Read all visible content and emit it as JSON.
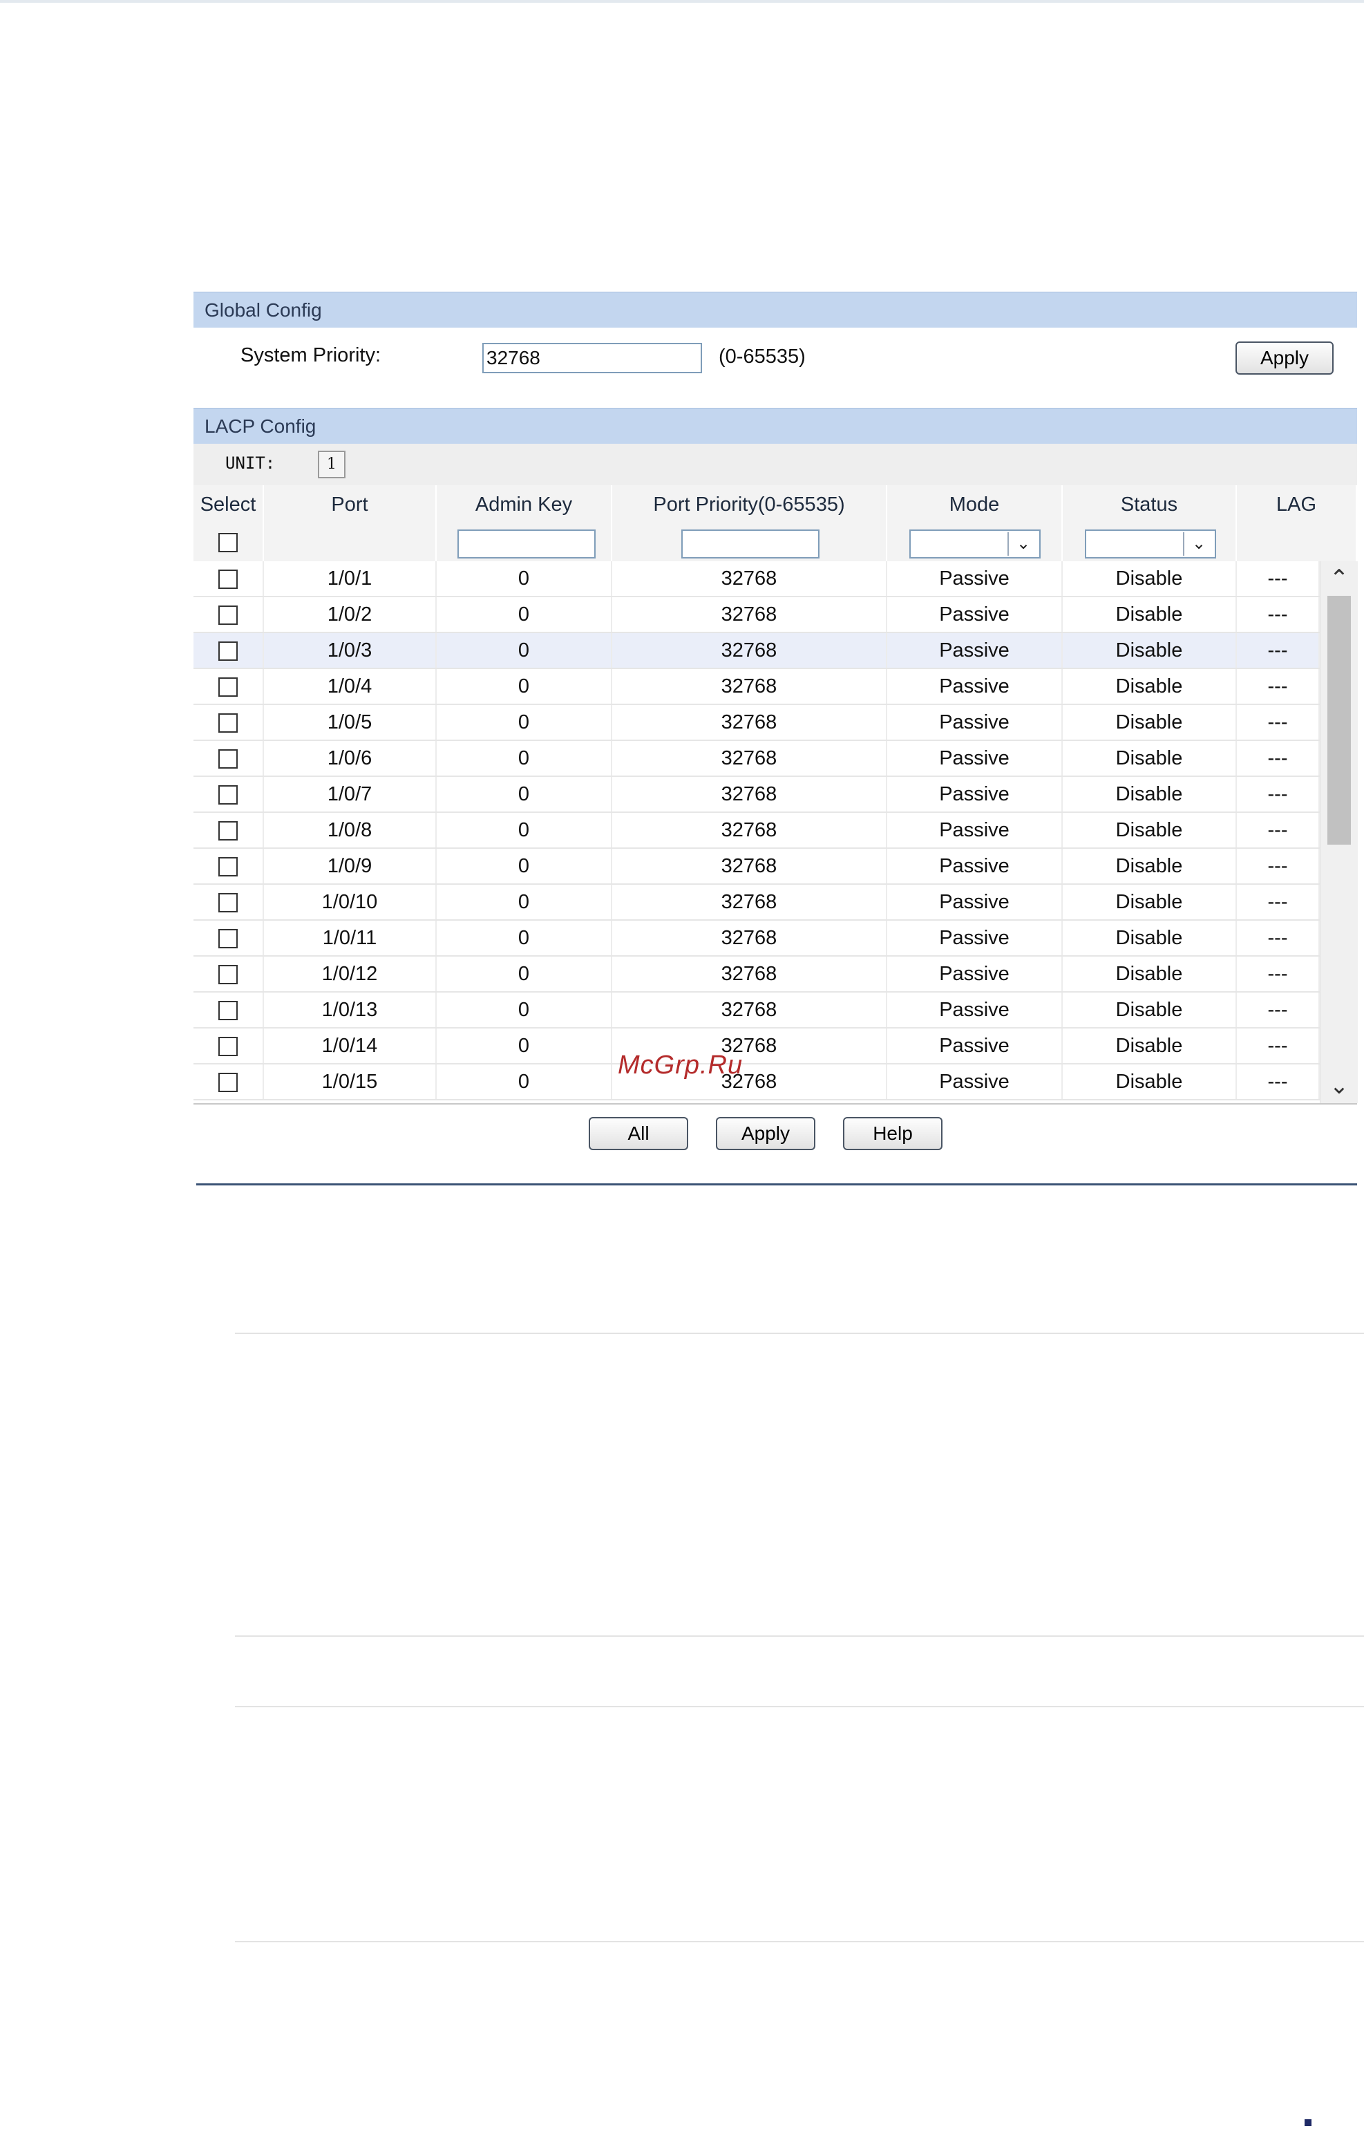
{
  "global_config": {
    "title": "Global Config",
    "system_priority_label": "System Priority:",
    "system_priority_value": "32768",
    "system_priority_range": "(0-65535)",
    "apply_label": "Apply"
  },
  "lacp_config": {
    "title": "LACP Config",
    "unit_label": "UNIT:",
    "unit_value": "1",
    "columns": [
      "Select",
      "Port",
      "Admin Key",
      "Port Priority(0-65535)",
      "Mode",
      "Status",
      "LAG"
    ],
    "rows": [
      {
        "port": "1/0/1",
        "admin_key": "0",
        "priority": "32768",
        "mode": "Passive",
        "status": "Disable",
        "lag": "---"
      },
      {
        "port": "1/0/2",
        "admin_key": "0",
        "priority": "32768",
        "mode": "Passive",
        "status": "Disable",
        "lag": "---"
      },
      {
        "port": "1/0/3",
        "admin_key": "0",
        "priority": "32768",
        "mode": "Passive",
        "status": "Disable",
        "lag": "---"
      },
      {
        "port": "1/0/4",
        "admin_key": "0",
        "priority": "32768",
        "mode": "Passive",
        "status": "Disable",
        "lag": "---"
      },
      {
        "port": "1/0/5",
        "admin_key": "0",
        "priority": "32768",
        "mode": "Passive",
        "status": "Disable",
        "lag": "---"
      },
      {
        "port": "1/0/6",
        "admin_key": "0",
        "priority": "32768",
        "mode": "Passive",
        "status": "Disable",
        "lag": "---"
      },
      {
        "port": "1/0/7",
        "admin_key": "0",
        "priority": "32768",
        "mode": "Passive",
        "status": "Disable",
        "lag": "---"
      },
      {
        "port": "1/0/8",
        "admin_key": "0",
        "priority": "32768",
        "mode": "Passive",
        "status": "Disable",
        "lag": "---"
      },
      {
        "port": "1/0/9",
        "admin_key": "0",
        "priority": "32768",
        "mode": "Passive",
        "status": "Disable",
        "lag": "---"
      },
      {
        "port": "1/0/10",
        "admin_key": "0",
        "priority": "32768",
        "mode": "Passive",
        "status": "Disable",
        "lag": "---"
      },
      {
        "port": "1/0/11",
        "admin_key": "0",
        "priority": "32768",
        "mode": "Passive",
        "status": "Disable",
        "lag": "---"
      },
      {
        "port": "1/0/12",
        "admin_key": "0",
        "priority": "32768",
        "mode": "Passive",
        "status": "Disable",
        "lag": "---"
      },
      {
        "port": "1/0/13",
        "admin_key": "0",
        "priority": "32768",
        "mode": "Passive",
        "status": "Disable",
        "lag": "---"
      },
      {
        "port": "1/0/14",
        "admin_key": "0",
        "priority": "32768",
        "mode": "Passive",
        "status": "Disable",
        "lag": "---"
      },
      {
        "port": "1/0/15",
        "admin_key": "0",
        "priority": "32768",
        "mode": "Passive",
        "status": "Disable",
        "lag": "---"
      }
    ],
    "highlighted_row": "1/0/3",
    "buttons": {
      "all": "All",
      "apply": "Apply",
      "help": "Help"
    }
  },
  "watermark": "McGrp.Ru"
}
